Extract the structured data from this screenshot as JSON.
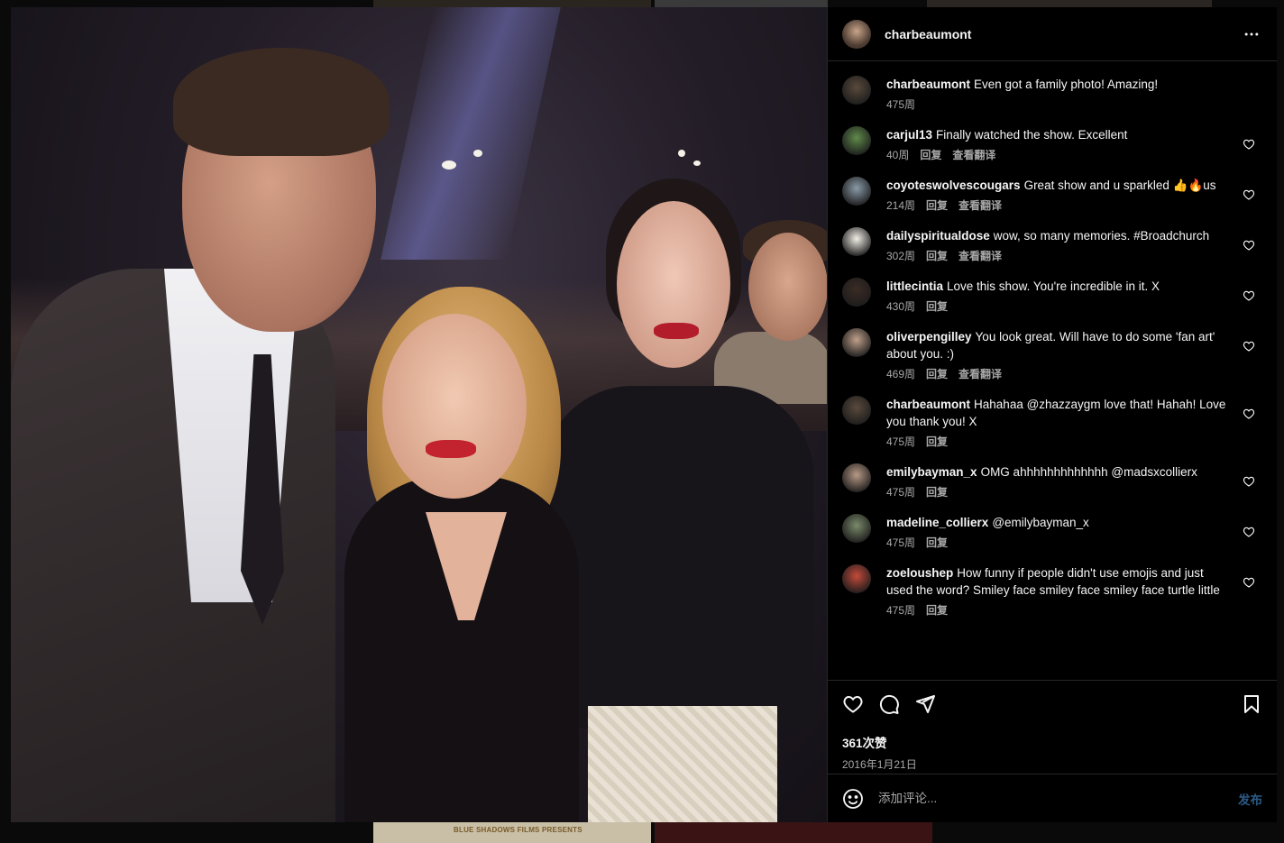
{
  "post": {
    "username": "charbeaumont",
    "likes": "361次赞",
    "date": "2016年1月21日"
  },
  "labels": {
    "reply": "回复",
    "translate": "查看翻译"
  },
  "comments": [
    {
      "user": "charbeaumont",
      "text": "Even got a family photo! Amazing!",
      "time": "475周",
      "reply": false,
      "translate": false,
      "heart": false,
      "avatar_color": "#5a4a3c"
    },
    {
      "user": "carjul13",
      "text": "Finally watched the show. Excellent",
      "time": "40周",
      "reply": true,
      "translate": true,
      "heart": true,
      "avatar_color": "#5f8a4a"
    },
    {
      "user": "coyoteswolvescougars",
      "text": "Great show and u sparkled 👍🔥us",
      "time": "214周",
      "reply": true,
      "translate": true,
      "heart": true,
      "avatar_color": "#8a9aa8"
    },
    {
      "user": "dailyspiritualdose",
      "text": "wow, so many memories. #Broadchurch",
      "time": "302周",
      "reply": true,
      "translate": true,
      "heart": true,
      "avatar_color": "#f2eee6"
    },
    {
      "user": "littlecintia",
      "text": "Love this show. You're incredible in it. X",
      "time": "430周",
      "reply": true,
      "translate": false,
      "heart": true,
      "avatar_color": "#3b2b24"
    },
    {
      "user": "oliverpengilley",
      "text": "You look great. Will have to do some 'fan art' about you. :)",
      "time": "469周",
      "reply": true,
      "translate": true,
      "heart": true,
      "avatar_color": "#c0a08a"
    },
    {
      "user": "charbeaumont",
      "text": "Hahahaa @zhazzaygm love that! Hahah! Love you thank you! X",
      "time": "475周",
      "reply": true,
      "translate": false,
      "heart": true,
      "avatar_color": "#5a4a3c"
    },
    {
      "user": "emilybayman_x",
      "text": "OMG ahhhhhhhhhhhhh @madsxcollierx",
      "time": "475周",
      "reply": true,
      "translate": false,
      "heart": true,
      "avatar_color": "#b89a86"
    },
    {
      "user": "madeline_collierx",
      "text": "@emilybayman_x",
      "time": "475周",
      "reply": true,
      "translate": false,
      "heart": true,
      "avatar_color": "#7a8a6a"
    },
    {
      "user": "zoeloushep",
      "text": "How funny if people didn't use emojis and just used the word? Smiley face smiley face smiley face turtle little",
      "time": "475周",
      "reply": true,
      "translate": false,
      "heart": true,
      "avatar_color": "#c44a3a"
    }
  ],
  "input": {
    "placeholder": "添加评论...",
    "post_label": "发布"
  },
  "backdrop": {
    "tile_text": "BLUE SHADOWS FILMS PRESENTS"
  },
  "icons": {
    "more": "more-horizontal-icon",
    "like": "heart-icon",
    "comment": "comment-icon",
    "share": "send-icon",
    "save": "bookmark-icon",
    "emoji": "emoji-icon"
  }
}
